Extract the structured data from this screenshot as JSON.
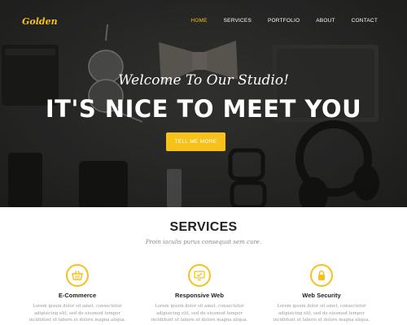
{
  "nav": {
    "logo": "Golden",
    "items": [
      {
        "label": "HOME",
        "active": true
      },
      {
        "label": "SERVICES",
        "active": false
      },
      {
        "label": "PORTFOLIO",
        "active": false
      },
      {
        "label": "ABOUT",
        "active": false
      },
      {
        "label": "CONTACT",
        "active": false
      }
    ]
  },
  "hero": {
    "subtitle": "Welcome To Our Studio!",
    "title": "IT'S NICE TO MEET YOU",
    "button_label": "TELL ME MORE"
  },
  "services": {
    "title": "SERVICES",
    "subtitle": "Proin iaculis purus consequat sem cure.",
    "items": [
      {
        "icon": "shopping-basket-icon",
        "name": "E-Commerce",
        "text": "Lorem ipsum dolor sit amet, consectetur adipisicing elit, sed do eiusmod tempor incididunt ut labore et dolore magna aliqua."
      },
      {
        "icon": "monitor-check-icon",
        "name": "Responsive Web",
        "text": "Lorem ipsum dolor sit amet, consectetur adipisicing elit, sed do eiusmod tempor incididunt ut labore et dolore magna aliqua."
      },
      {
        "icon": "padlock-icon",
        "name": "Web Security",
        "text": "Lorem ipsum dolor sit amet, consectetur adipisicing elit, sed do eiusmod tempor incididunt ut labore et dolore magna aliqua."
      }
    ]
  },
  "colors": {
    "accent": "#f6c21a",
    "hero_bg": "#2f2f2e",
    "heading": "#222222",
    "muted": "#9a9a9a"
  }
}
